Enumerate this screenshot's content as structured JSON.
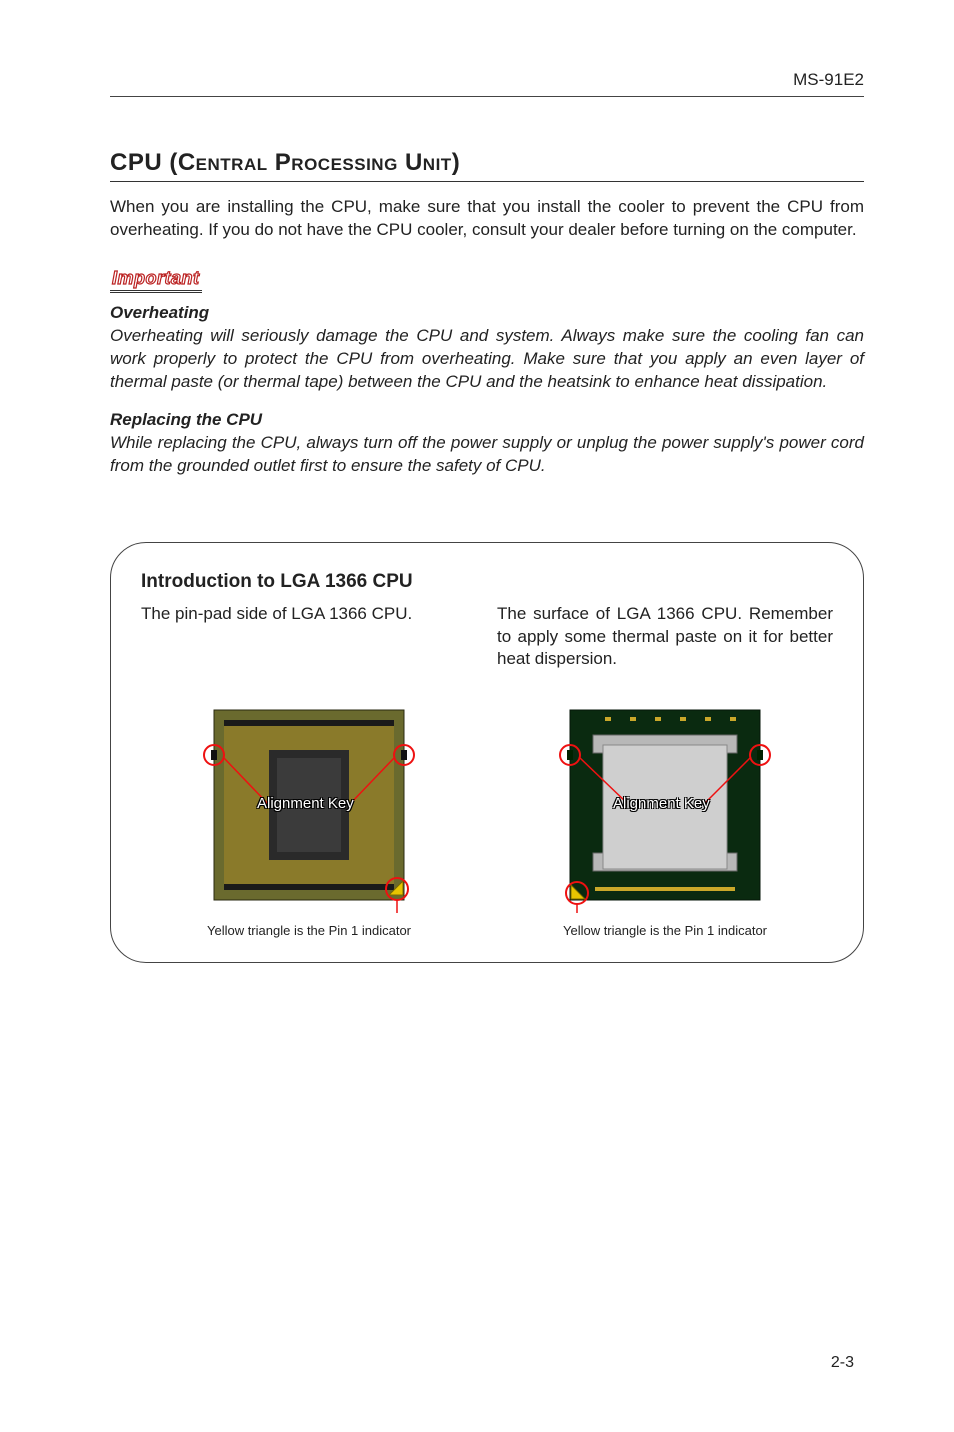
{
  "header": {
    "doc_id": "MS-91E2"
  },
  "title": {
    "prefix": "CPU (",
    "sc_part": "Central Processing Unit",
    "suffix": ")"
  },
  "intro": "When you are installing the CPU, make sure that you install the cooler to prevent the CPU from overheating. If you do not have the CPU cooler, consult your dealer before turning on the computer.",
  "important_label": "Important",
  "overheating": {
    "head": "Overheating",
    "body": "Overheating will seriously damage the CPU and system. Always make sure the cooling fan can work properly to protect the CPU from overheating. Make sure that you apply an even layer of thermal paste (or thermal tape) between the CPU and the heatsink to enhance heat dissipation."
  },
  "replacing": {
    "head": "Replacing the CPU",
    "body": "While replacing the CPU, always turn off the power supply or unplug the power supply's power cord from the grounded outlet first to ensure the safety of CPU."
  },
  "box": {
    "title": "Introduction to LGA 1366 CPU",
    "left_cap": "The pin-pad side of LGA 1366 CPU.",
    "right_cap": "The surface of LGA 1366 CPU. Remember to apply some thermal paste on it for better heat dispersion.",
    "align_label": "Alignment Key",
    "pin1_caption": "Yellow triangle is the Pin 1 indicator"
  },
  "page_number": "2-3"
}
